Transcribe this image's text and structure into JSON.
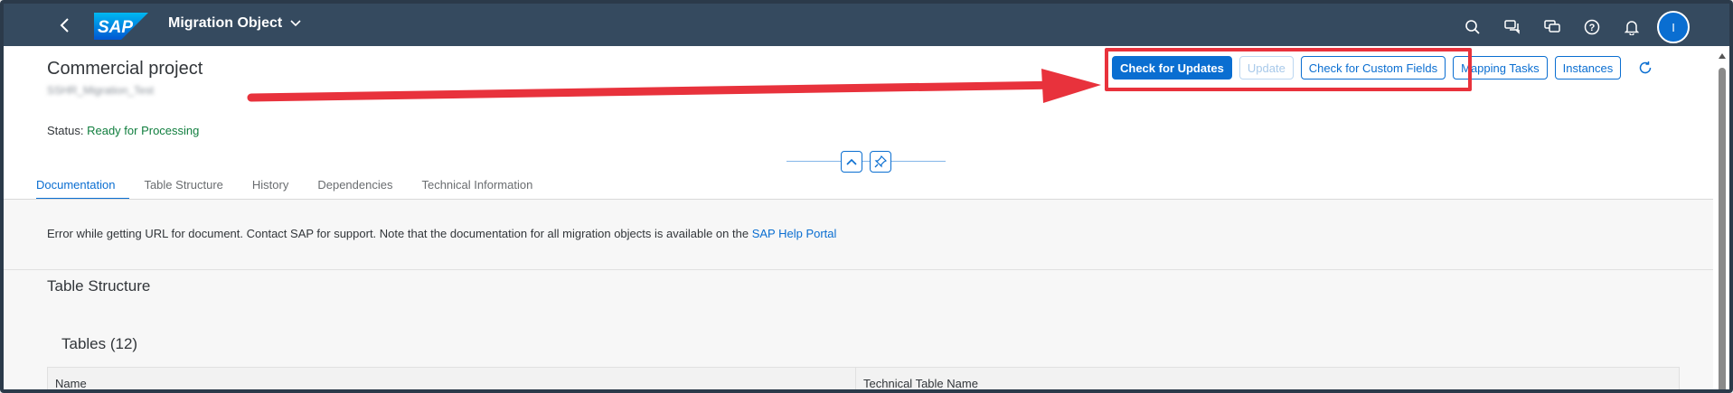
{
  "shell": {
    "logo_text": "SAP",
    "app_title": "Migration Object",
    "avatar_initial": "I"
  },
  "header": {
    "title": "Commercial project",
    "subtitle": "SSHR_Migration_Test",
    "status_label": "Status:",
    "status_value": "Ready for Processing",
    "actions": {
      "check_updates": "Check for Updates",
      "update": "Update",
      "check_custom": "Check for Custom Fields",
      "mapping_tasks": "Mapping Tasks",
      "instances": "Instances"
    }
  },
  "tabs": [
    {
      "label": "Documentation"
    },
    {
      "label": "Table Structure"
    },
    {
      "label": "History"
    },
    {
      "label": "Dependencies"
    },
    {
      "label": "Technical Information"
    }
  ],
  "documentation": {
    "message": "Error while getting URL for document. Contact SAP for support. Note that the documentation for all migration objects is available on the",
    "link": "SAP Help Portal"
  },
  "table_structure": {
    "section_title": "Table Structure",
    "tables_title": "Tables (12)",
    "columns": [
      "Name",
      "Technical Table Name"
    ]
  },
  "colors": {
    "shell": "#354a5f",
    "accent": "#0a6ed1",
    "status_green": "#107e3e",
    "highlight_red": "#e8323c"
  }
}
